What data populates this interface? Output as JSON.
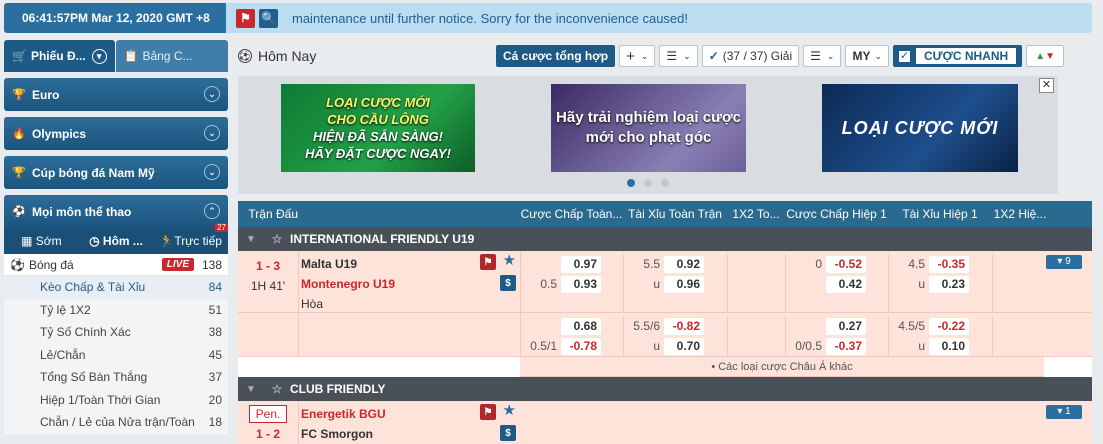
{
  "topbar": {
    "time": "06:41:57PM Mar 12, 2020 GMT +8",
    "marquee": "maintenance until further notice. Sorry for the inconvenience caused!"
  },
  "sidebar": {
    "tabs": [
      "Phiếu Đ...",
      "Bảng C..."
    ],
    "groups": [
      {
        "label": "Euro"
      },
      {
        "label": "Olympics"
      },
      {
        "label": "Cúp bóng đá Nam Mỹ"
      },
      {
        "label": "Mọi môn thể thao"
      }
    ],
    "subtabs": {
      "early": "Sớm",
      "today": "Hôm ...",
      "live": "Trực tiếp",
      "live_count": "27"
    },
    "sport": {
      "label": "Bóng đá",
      "live": "LIVE",
      "count": "138"
    },
    "items": [
      {
        "label": "Kèo Chấp & Tài Xỉu",
        "count": "84"
      },
      {
        "label": "Tỷ lệ 1X2",
        "count": "51"
      },
      {
        "label": "Tỷ Số Chính Xác",
        "count": "38"
      },
      {
        "label": "Lẻ/Chẵn",
        "count": "45"
      },
      {
        "label": "Tổng Số Bàn Thắng",
        "count": "37"
      },
      {
        "label": "Hiệp 1/Toàn Thời Gian",
        "count": "20"
      },
      {
        "label": "Chẵn / Lẻ của Nửa trận/Toàn",
        "count": "18"
      }
    ]
  },
  "header": {
    "title": "Hôm Nay",
    "combo_bet": "Cá cược tổng hợp",
    "plus": "+",
    "count": "(37 / 37) Giải",
    "my": "MY",
    "quick_bet": "CƯỢC NHANH"
  },
  "banners": [
    {
      "lines": [
        "LOẠI CƯỢC MỚI",
        "CHO CẦU LÔNG",
        "HIỆN ĐÃ SẴN SÀNG!",
        "HÃY ĐẶT CƯỢC NGAY!"
      ]
    },
    {
      "lines": [
        "Hãy trải nghiệm loại cược",
        "mới cho phạt góc"
      ]
    },
    {
      "lines": [
        "LOẠI CƯỢC MỚI"
      ]
    }
  ],
  "table": {
    "columns": [
      "Trận Đấu",
      "Cược Chấp Toàn...",
      "Tài Xỉu Toàn Trận",
      "1X2 To...",
      "Cược Chấp Hiệp 1",
      "Tài Xỉu Hiệp 1",
      "1X2 Hiệ..."
    ],
    "leagues": [
      {
        "name": "INTERNATIONAL FRIENDLY U19",
        "match": {
          "score": "1 - 3",
          "live_time": "1H 41'",
          "home": "Malta U19",
          "away": "Montenegro U19",
          "draw": "Hòa",
          "more": "▾ 9",
          "lines": [
            {
              "hdp_h": "",
              "hdp_home": "0.97",
              "ou_h": "5.5",
              "ou_over": "0.92",
              "h1_h": "0",
              "h1_home": "-0.52",
              "h1ou_h": "4.5",
              "h1ou_over": "-0.35"
            },
            {
              "hdp_h": "0.5",
              "hdp_home": "0.93",
              "ou_h": "u",
              "ou_over": "0.96",
              "h1_h": "",
              "h1_home": "0.42",
              "h1ou_h": "u",
              "h1ou_over": "0.23"
            },
            {
              "hdp_h": "",
              "hdp_home": "0.68",
              "ou_h": "5.5/6",
              "ou_over": "-0.82",
              "h1_h": "",
              "h1_home": "0.27",
              "h1ou_h": "4.5/5",
              "h1ou_over": "-0.22"
            },
            {
              "hdp_h": "0.5/1",
              "hdp_home": "-0.78",
              "ou_h": "u",
              "ou_over": "0.70",
              "h1_h": "0/0.5",
              "h1_home": "-0.37",
              "h1ou_h": "u",
              "h1ou_over": "0.10"
            }
          ],
          "other": "• Các loại cược Châu Á khác"
        }
      },
      {
        "name": "CLUB FRIENDLY",
        "match": {
          "status": "Pen.",
          "score": "1 - 2",
          "home": "Energetik BGU",
          "away": "FC Smorgon",
          "more": "▾ 1"
        }
      }
    ]
  }
}
